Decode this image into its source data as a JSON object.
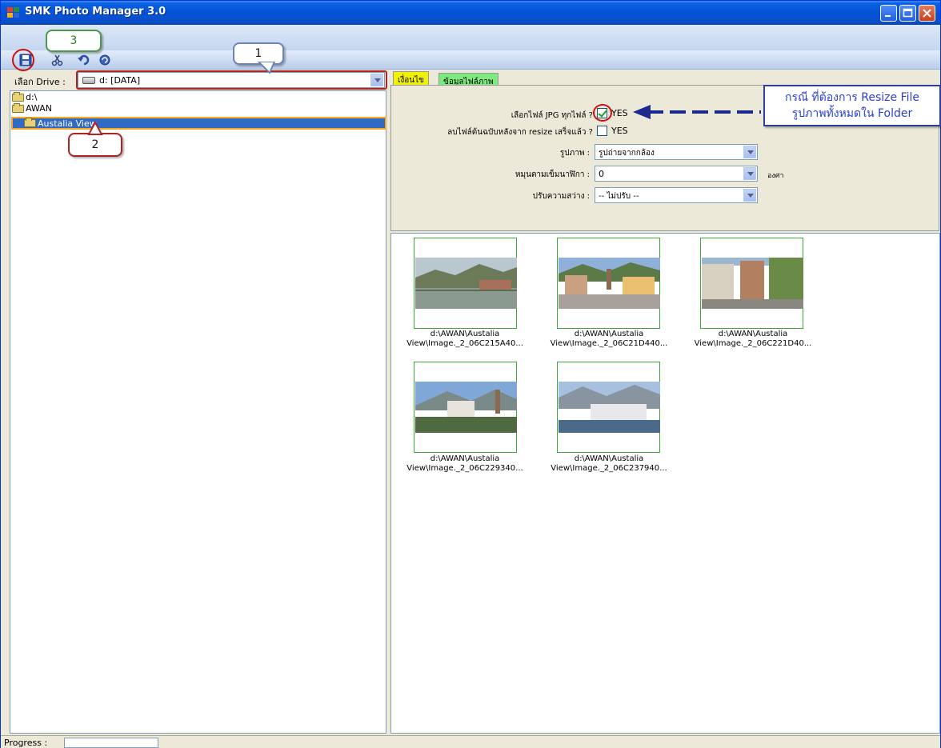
{
  "window": {
    "title": "SMK Photo Manager 3.0"
  },
  "drive": {
    "label": "เลือก Drive :",
    "value": "d: [DATA]"
  },
  "tree": {
    "items": [
      {
        "label": "d:\\"
      },
      {
        "label": "AWAN"
      },
      {
        "label": "Austalia View"
      }
    ]
  },
  "tabs": [
    {
      "label": "เงื่อนไข"
    },
    {
      "label": "ข้อมูลไฟล์ภาพ"
    }
  ],
  "options": {
    "select_all_label": "เลือกไฟล์ JPG ทุกไฟล์ ?",
    "select_all_value": "YES",
    "delete_original_label": "ลบไฟล์ต้นฉบับหลังจาก resize เสร็จแล้ว ?",
    "delete_original_value": "YES",
    "image_type_label": "รูปภาพ :",
    "image_type_value": "รูปถ่ายจากกล้อง",
    "rotate_label": "หมุนตามเข็มนาฬิกา :",
    "rotate_value": "0",
    "rotate_unit": "องศา",
    "brightness_label": "ปรับความสว่าง :",
    "brightness_value": "-- ไม่ปรับ --"
  },
  "thumbnails": [
    {
      "line1": "d:\\AWAN\\Austalia",
      "line2": "View\\Image._2_06C215A40..."
    },
    {
      "line1": "d:\\AWAN\\Austalia",
      "line2": "View\\Image._2_06C21D440..."
    },
    {
      "line1": "d:\\AWAN\\Austalia",
      "line2": "View\\Image._2_06C221D40..."
    },
    {
      "line1": "d:\\AWAN\\Austalia",
      "line2": "View\\Image._2_06C229340..."
    },
    {
      "line1": "d:\\AWAN\\Austalia",
      "line2": "View\\Image._2_06C237940..."
    }
  ],
  "annotations": {
    "callout_1": "1",
    "callout_2": "2",
    "callout_3": "3",
    "note_line1": "กรณี ที่ต้องการ Resize File",
    "note_line2": "รูปภาพทั้งหมดใน Folder"
  },
  "status": {
    "progress_label": "Progress :"
  },
  "colors": {
    "titlebar": "#0553D8",
    "tab_active": "#F2F200",
    "tab_inactive": "#7FE87F",
    "selection": "#316AC5",
    "annotation_red": "#B22222",
    "thumb_border": "#3BA83B"
  }
}
